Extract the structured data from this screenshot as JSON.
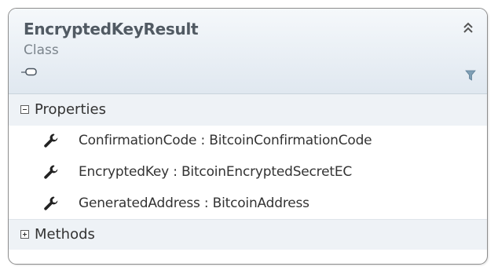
{
  "class_shape": {
    "name": "EncryptedKeyResult",
    "kind": "Class"
  },
  "compartments": {
    "properties_label": "Properties",
    "methods_label": "Methods",
    "properties_expanded": true,
    "methods_expanded": false
  },
  "properties": [
    {
      "name": "ConfirmationCode",
      "type": "BitcoinConfirmationCode",
      "display": "ConfirmationCode : BitcoinConfirmationCode"
    },
    {
      "name": "EncryptedKey",
      "type": "BitcoinEncryptedSecretEC",
      "display": "EncryptedKey : BitcoinEncryptedSecretEC"
    },
    {
      "name": "GeneratedAddress",
      "type": "BitcoinAddress",
      "display": "GeneratedAddress : BitcoinAddress"
    }
  ],
  "icons": {
    "collapse": "double-chevron-up-icon",
    "class_glyph": "class-shape-icon",
    "filter": "filter-icon",
    "property": "wrench-icon"
  },
  "colors": {
    "header_top": "#f5f8fb",
    "header_bottom": "#e0e8f0",
    "border": "#8d8d8d",
    "title": "#515a63",
    "filter": "#7f9fb5"
  }
}
